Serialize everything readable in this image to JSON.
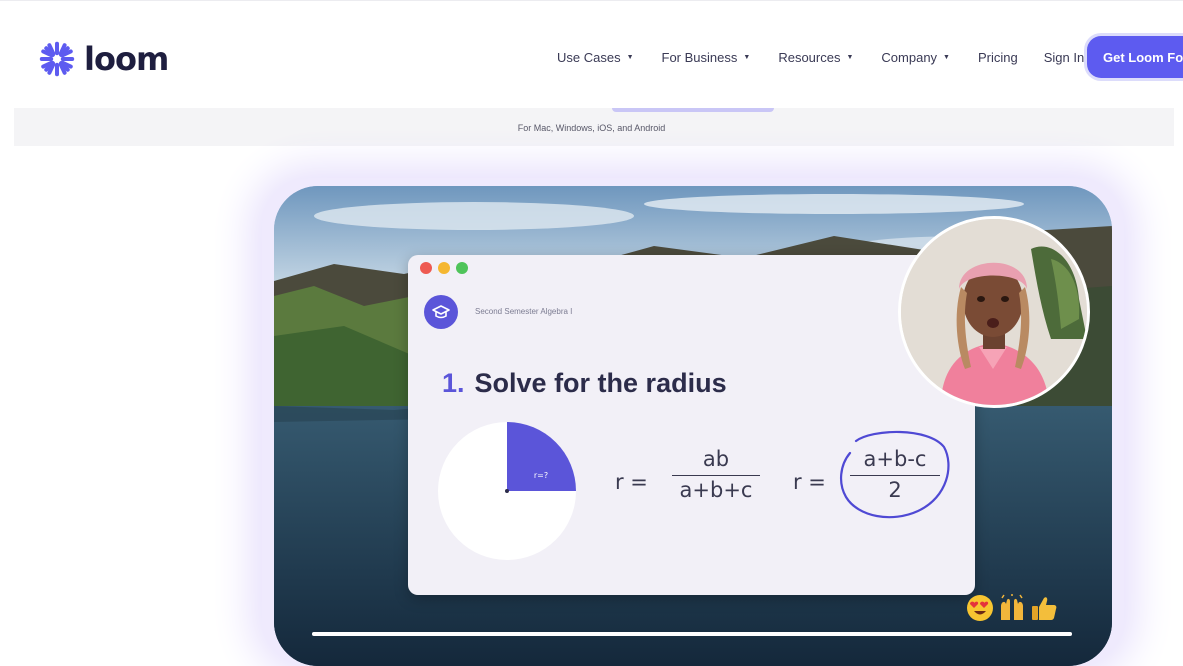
{
  "brand": {
    "name": "loom",
    "accent": "#5d5bf0",
    "logo_icon": "loom-asterisk-icon"
  },
  "nav": {
    "items": [
      {
        "label": "Use Cases",
        "has_dropdown": true
      },
      {
        "label": "For Business",
        "has_dropdown": true
      },
      {
        "label": "Resources",
        "has_dropdown": true
      },
      {
        "label": "Company",
        "has_dropdown": true
      },
      {
        "label": "Pricing",
        "has_dropdown": false
      },
      {
        "label": "Sign In",
        "has_dropdown": false
      }
    ],
    "cta_label": "Get Loom Fo"
  },
  "hero": {
    "platforms": "For Mac, Windows, iOS, and Android"
  },
  "video": {
    "progress": 1.0,
    "slide": {
      "course": "Second Semester Algebra I",
      "question_number": "1.",
      "question_text": "Solve for the radius",
      "pie_label": "r=?",
      "eq1_lhs": "r =",
      "eq1_numerator": "ab",
      "eq1_denominator": "a+b+c",
      "eq2_lhs": "r =",
      "eq2_numerator": "a+b-c",
      "eq2_denominator": "2",
      "window_dots": [
        "#ee5a52",
        "#f5b731",
        "#4fc45a"
      ],
      "badge_icon": "graduation-cap-icon"
    },
    "reactions": [
      "heart-eyes-emoji",
      "raised-hands-emoji",
      "thumbs-up-emoji"
    ]
  }
}
